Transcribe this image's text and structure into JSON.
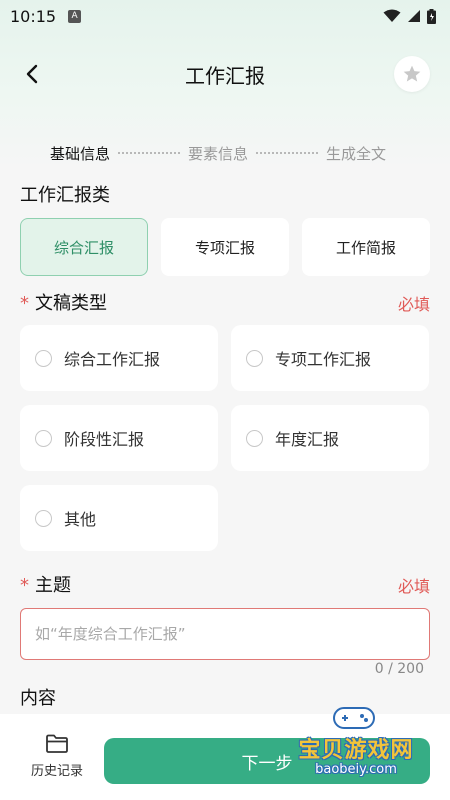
{
  "status_bar": {
    "time": "10:15",
    "notification_badge": "A"
  },
  "header": {
    "title": "工作汇报"
  },
  "steps": [
    {
      "label": "基础信息",
      "active": true
    },
    {
      "label": "要素信息",
      "active": false
    },
    {
      "label": "生成全文",
      "active": false
    }
  ],
  "report_category": {
    "title": "工作汇报类",
    "tabs": [
      {
        "label": "综合汇报",
        "selected": true
      },
      {
        "label": "专项汇报",
        "selected": false
      },
      {
        "label": "工作简报",
        "selected": false
      }
    ]
  },
  "document_type": {
    "required_mark": "*",
    "title": "文稿类型",
    "required_label": "必填",
    "options": [
      {
        "label": "综合工作汇报"
      },
      {
        "label": "专项工作汇报"
      },
      {
        "label": "阶段性汇报"
      },
      {
        "label": "年度汇报"
      },
      {
        "label": "其他"
      }
    ]
  },
  "topic": {
    "required_mark": "*",
    "title": "主题",
    "required_label": "必填",
    "value": "",
    "placeholder": "如“年度综合工作汇报”",
    "counter": "0 / 200"
  },
  "content": {
    "title": "内容"
  },
  "bottom_bar": {
    "history_label": "历史记录",
    "next_label": "下一步"
  },
  "watermark": {
    "line1": "宝贝游戏网",
    "line2": "baobeiy.com"
  },
  "colors": {
    "accent": "#36ad85",
    "required": "#e05a57",
    "selected_bg": "#e3f3ea"
  },
  "icons": [
    "back-arrow-icon",
    "star-icon",
    "folder-icon",
    "radio-icon",
    "wifi-icon",
    "signal-icon",
    "battery-icon"
  ]
}
